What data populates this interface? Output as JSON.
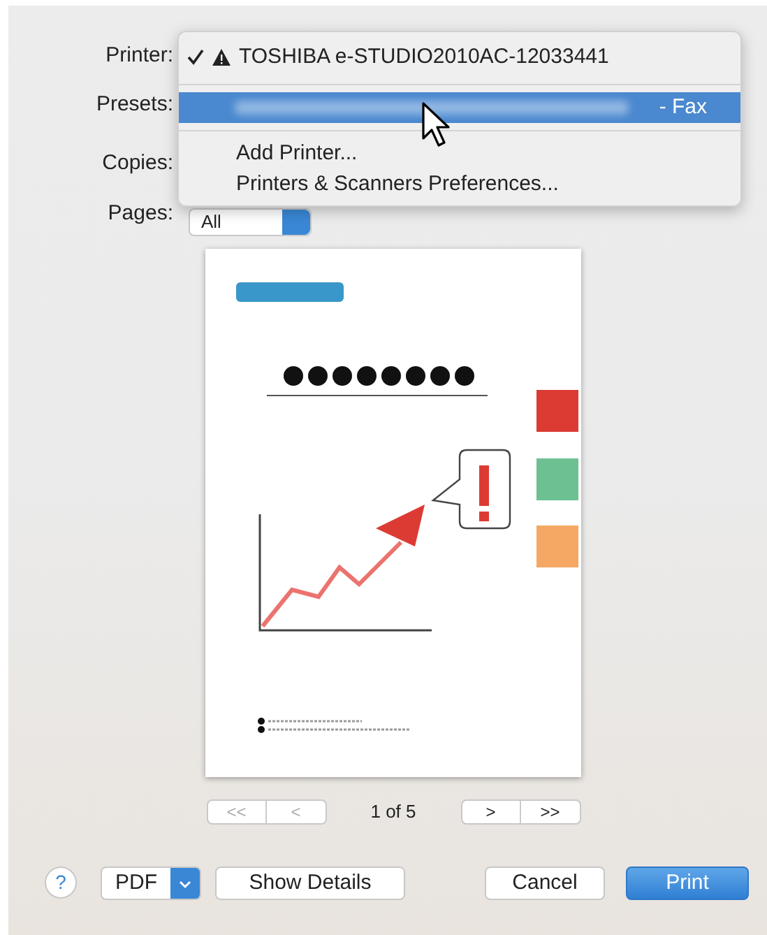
{
  "form": [
    {
      "label": "Printer:"
    },
    {
      "label": "Presets:"
    },
    {
      "label": "Copies:"
    },
    {
      "label": "Pages:",
      "value": "All"
    }
  ],
  "printer_menu": {
    "items": [
      {
        "kind": "printer",
        "checked": true,
        "warning": true,
        "label": "TOSHIBA e-STUDIO2010AC-12033441",
        "selected": false
      },
      {
        "kind": "separator"
      },
      {
        "kind": "blurred",
        "suffix": "- Fax",
        "selected": true
      },
      {
        "kind": "separator"
      },
      {
        "kind": "action",
        "label": "Add Printer...",
        "selected": false
      },
      {
        "kind": "action",
        "label": "Printers & Scanners Preferences...",
        "selected": false
      }
    ]
  },
  "pager": {
    "first": "<<",
    "prev": "<",
    "status": "1 of 5",
    "next": ">",
    "last": ">>"
  },
  "footer": {
    "help": "?",
    "pdf": "PDF",
    "buttons": [
      {
        "label": "Show Details",
        "kind": "normal"
      },
      {
        "label": "Cancel",
        "kind": "normal"
      },
      {
        "label": "Print",
        "kind": "default"
      }
    ]
  }
}
